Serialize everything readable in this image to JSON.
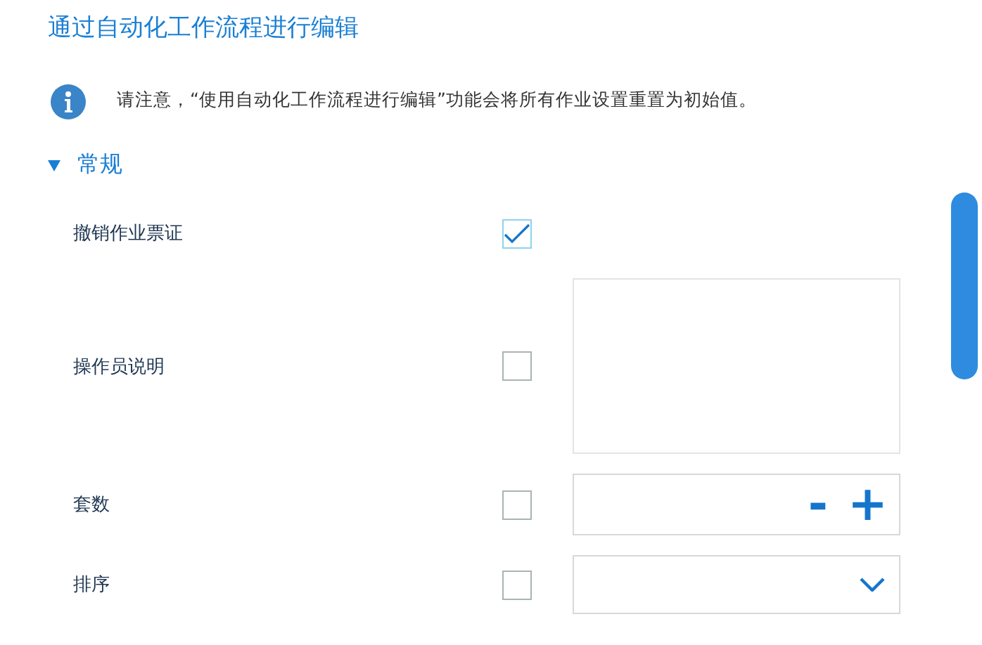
{
  "title": "通过自动化工作流程进行编辑",
  "notice": {
    "text": "请注意，“使用自动化工作流程进行编辑”功能会将所有作业设置重置为初始值。"
  },
  "section": {
    "label": "常规",
    "expanded": true,
    "rows": [
      {
        "label": "撤销作业票证",
        "checked": true,
        "kind": "plain"
      },
      {
        "label": "操作员说明",
        "checked": false,
        "kind": "textarea"
      },
      {
        "label": "套数",
        "checked": false,
        "kind": "stepper",
        "minus": "-",
        "plus": "+"
      },
      {
        "label": "排序",
        "checked": false,
        "kind": "dropdown"
      }
    ]
  }
}
